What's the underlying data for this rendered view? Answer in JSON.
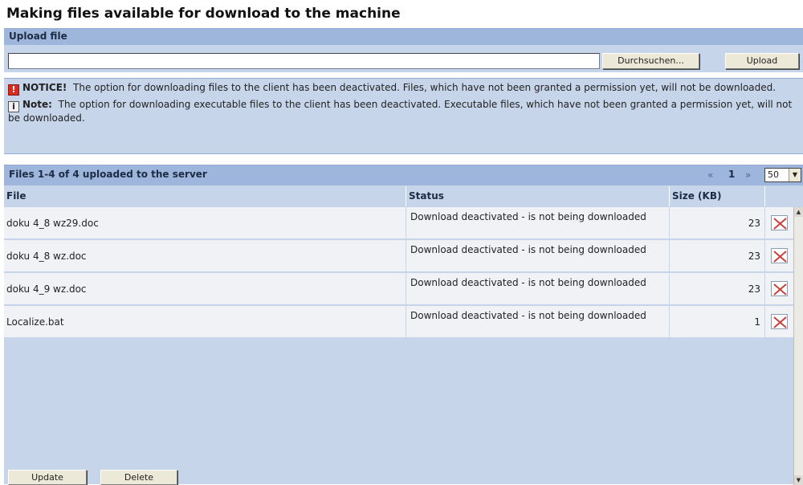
{
  "page": {
    "title": "Making files available for download to the machine"
  },
  "upload": {
    "header": "Upload file",
    "file_value": "",
    "browse_label": "Durchsuchen...",
    "upload_label": "Upload"
  },
  "notices": {
    "notice_title": "NOTICE!",
    "notice_text": "The option for downloading files to the client has been deactivated. Files, which have not been granted a permission yet, will not be downloaded.",
    "note_title": "Note:",
    "note_text": "The option for downloading executable files to the client has been deactivated. Executable files, which have not been granted a permission yet, will not be downloaded.",
    "warn_glyph": "!",
    "info_glyph": "i"
  },
  "files": {
    "header": "Files 1-4 of 4 uploaded to the server",
    "pager": {
      "first": "«",
      "page": "1",
      "last": "»",
      "page_size": "50"
    },
    "columns": {
      "file": "File",
      "status": "Status",
      "size": "Size (KB)"
    },
    "rows": [
      {
        "file": "doku 4_8 wz29.doc",
        "status": "Download deactivated - is not being downloaded",
        "size": "23"
      },
      {
        "file": "doku 4_8 wz.doc",
        "status": "Download deactivated - is not being downloaded",
        "size": "23"
      },
      {
        "file": "doku 4_9 wz.doc",
        "status": "Download deactivated - is not being downloaded",
        "size": "23"
      },
      {
        "file": "Localize.bat",
        "status": "Download deactivated - is not being downloaded",
        "size": "1"
      }
    ],
    "update_label": "Update",
    "delete_label": "Delete"
  }
}
